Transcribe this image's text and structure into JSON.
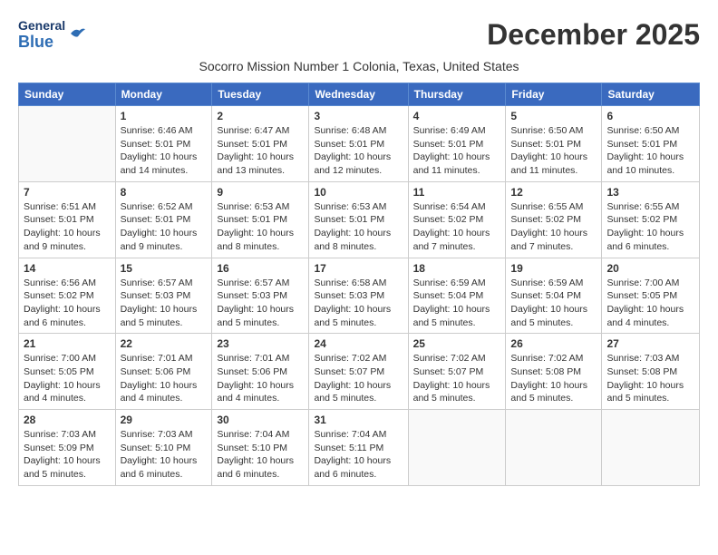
{
  "header": {
    "logo_line1": "General",
    "logo_line2": "Blue",
    "month_title": "December 2025",
    "subtitle": "Socorro Mission Number 1 Colonia, Texas, United States"
  },
  "days_of_week": [
    "Sunday",
    "Monday",
    "Tuesday",
    "Wednesday",
    "Thursday",
    "Friday",
    "Saturday"
  ],
  "weeks": [
    [
      {
        "day": "",
        "info": ""
      },
      {
        "day": "1",
        "info": "Sunrise: 6:46 AM\nSunset: 5:01 PM\nDaylight: 10 hours\nand 14 minutes."
      },
      {
        "day": "2",
        "info": "Sunrise: 6:47 AM\nSunset: 5:01 PM\nDaylight: 10 hours\nand 13 minutes."
      },
      {
        "day": "3",
        "info": "Sunrise: 6:48 AM\nSunset: 5:01 PM\nDaylight: 10 hours\nand 12 minutes."
      },
      {
        "day": "4",
        "info": "Sunrise: 6:49 AM\nSunset: 5:01 PM\nDaylight: 10 hours\nand 11 minutes."
      },
      {
        "day": "5",
        "info": "Sunrise: 6:50 AM\nSunset: 5:01 PM\nDaylight: 10 hours\nand 11 minutes."
      },
      {
        "day": "6",
        "info": "Sunrise: 6:50 AM\nSunset: 5:01 PM\nDaylight: 10 hours\nand 10 minutes."
      }
    ],
    [
      {
        "day": "7",
        "info": "Sunrise: 6:51 AM\nSunset: 5:01 PM\nDaylight: 10 hours\nand 9 minutes."
      },
      {
        "day": "8",
        "info": "Sunrise: 6:52 AM\nSunset: 5:01 PM\nDaylight: 10 hours\nand 9 minutes."
      },
      {
        "day": "9",
        "info": "Sunrise: 6:53 AM\nSunset: 5:01 PM\nDaylight: 10 hours\nand 8 minutes."
      },
      {
        "day": "10",
        "info": "Sunrise: 6:53 AM\nSunset: 5:01 PM\nDaylight: 10 hours\nand 8 minutes."
      },
      {
        "day": "11",
        "info": "Sunrise: 6:54 AM\nSunset: 5:02 PM\nDaylight: 10 hours\nand 7 minutes."
      },
      {
        "day": "12",
        "info": "Sunrise: 6:55 AM\nSunset: 5:02 PM\nDaylight: 10 hours\nand 7 minutes."
      },
      {
        "day": "13",
        "info": "Sunrise: 6:55 AM\nSunset: 5:02 PM\nDaylight: 10 hours\nand 6 minutes."
      }
    ],
    [
      {
        "day": "14",
        "info": "Sunrise: 6:56 AM\nSunset: 5:02 PM\nDaylight: 10 hours\nand 6 minutes."
      },
      {
        "day": "15",
        "info": "Sunrise: 6:57 AM\nSunset: 5:03 PM\nDaylight: 10 hours\nand 5 minutes."
      },
      {
        "day": "16",
        "info": "Sunrise: 6:57 AM\nSunset: 5:03 PM\nDaylight: 10 hours\nand 5 minutes."
      },
      {
        "day": "17",
        "info": "Sunrise: 6:58 AM\nSunset: 5:03 PM\nDaylight: 10 hours\nand 5 minutes."
      },
      {
        "day": "18",
        "info": "Sunrise: 6:59 AM\nSunset: 5:04 PM\nDaylight: 10 hours\nand 5 minutes."
      },
      {
        "day": "19",
        "info": "Sunrise: 6:59 AM\nSunset: 5:04 PM\nDaylight: 10 hours\nand 5 minutes."
      },
      {
        "day": "20",
        "info": "Sunrise: 7:00 AM\nSunset: 5:05 PM\nDaylight: 10 hours\nand 4 minutes."
      }
    ],
    [
      {
        "day": "21",
        "info": "Sunrise: 7:00 AM\nSunset: 5:05 PM\nDaylight: 10 hours\nand 4 minutes."
      },
      {
        "day": "22",
        "info": "Sunrise: 7:01 AM\nSunset: 5:06 PM\nDaylight: 10 hours\nand 4 minutes."
      },
      {
        "day": "23",
        "info": "Sunrise: 7:01 AM\nSunset: 5:06 PM\nDaylight: 10 hours\nand 4 minutes."
      },
      {
        "day": "24",
        "info": "Sunrise: 7:02 AM\nSunset: 5:07 PM\nDaylight: 10 hours\nand 5 minutes."
      },
      {
        "day": "25",
        "info": "Sunrise: 7:02 AM\nSunset: 5:07 PM\nDaylight: 10 hours\nand 5 minutes."
      },
      {
        "day": "26",
        "info": "Sunrise: 7:02 AM\nSunset: 5:08 PM\nDaylight: 10 hours\nand 5 minutes."
      },
      {
        "day": "27",
        "info": "Sunrise: 7:03 AM\nSunset: 5:08 PM\nDaylight: 10 hours\nand 5 minutes."
      }
    ],
    [
      {
        "day": "28",
        "info": "Sunrise: 7:03 AM\nSunset: 5:09 PM\nDaylight: 10 hours\nand 5 minutes."
      },
      {
        "day": "29",
        "info": "Sunrise: 7:03 AM\nSunset: 5:10 PM\nDaylight: 10 hours\nand 6 minutes."
      },
      {
        "day": "30",
        "info": "Sunrise: 7:04 AM\nSunset: 5:10 PM\nDaylight: 10 hours\nand 6 minutes."
      },
      {
        "day": "31",
        "info": "Sunrise: 7:04 AM\nSunset: 5:11 PM\nDaylight: 10 hours\nand 6 minutes."
      },
      {
        "day": "",
        "info": ""
      },
      {
        "day": "",
        "info": ""
      },
      {
        "day": "",
        "info": ""
      }
    ]
  ]
}
